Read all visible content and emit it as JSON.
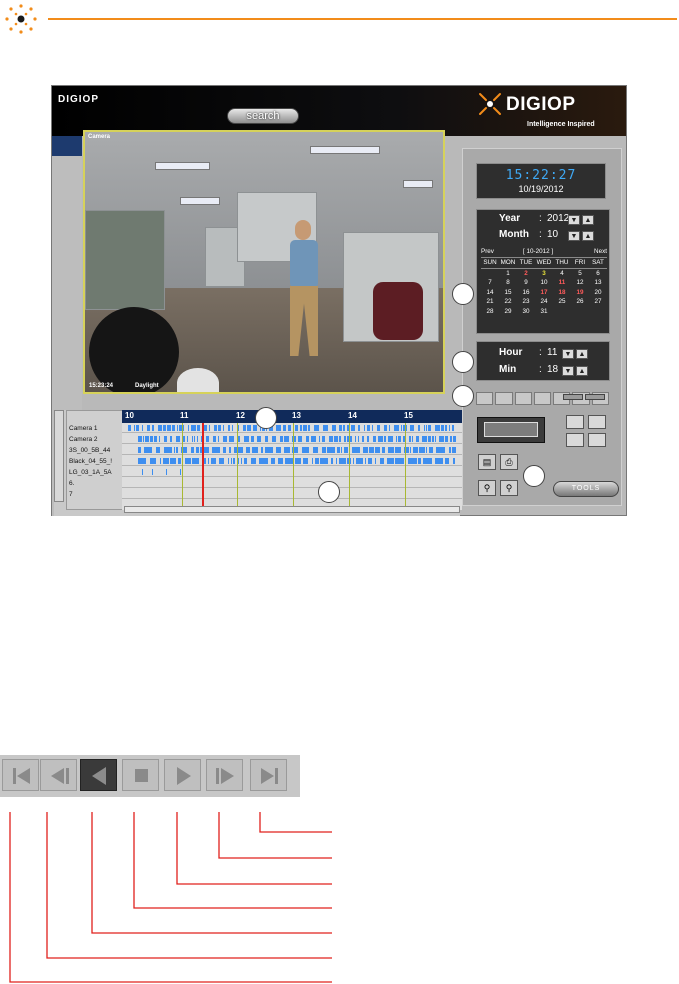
{
  "window": {
    "brand_small": "DIGIOP",
    "search_label": "search",
    "logo_name": "DIGIOP",
    "logo_tagline": "Intelligence Inspired",
    "tools_label": "TOOLS"
  },
  "video": {
    "camera_label": "Camera",
    "timestamp": "15:23:24",
    "mode": "Daylight"
  },
  "clock": {
    "time": "15:22:27",
    "date": "10/19/2012"
  },
  "calendar": {
    "year_label": "Year",
    "year_value": "2012",
    "month_label": "Month",
    "month_value": "10",
    "prev_label": "Prev",
    "current": "[ 10-2012 ]",
    "next_label": "Next",
    "weekdays": [
      "SUN",
      "MON",
      "TUE",
      "WED",
      "THU",
      "FRI",
      "SAT"
    ],
    "weeks": [
      [
        "",
        "1",
        "2",
        "3",
        "4",
        "5",
        "6"
      ],
      [
        "7",
        "8",
        "9",
        "10",
        "11",
        "12",
        "13"
      ],
      [
        "14",
        "15",
        "16",
        "17",
        "18",
        "19",
        "20"
      ],
      [
        "21",
        "22",
        "23",
        "24",
        "25",
        "26",
        "27"
      ],
      [
        "28",
        "29",
        "30",
        "31",
        "",
        "",
        ""
      ]
    ],
    "highlight_red": [
      "2",
      "11",
      "17",
      "18",
      "19"
    ],
    "highlight_yellow": [
      "3"
    ]
  },
  "time_select": {
    "hour_label": "Hour",
    "hour_value": "11",
    "min_label": "Min",
    "min_value": "18"
  },
  "timeline": {
    "hours": [
      "10",
      "11",
      "12",
      "13",
      "14",
      "15"
    ],
    "cameras": [
      "Camera 1",
      "Camera 2",
      "3S_00_5B_44",
      "Black_04_55_!",
      "LG_03_1A_5A",
      "6.",
      "7"
    ],
    "colors": {
      "header": "#102a5a",
      "recording": "#3e8ef0",
      "cursor": "#e0201c"
    }
  },
  "colors": {
    "accent": "#f28c1a",
    "leader": "#e0201c"
  }
}
